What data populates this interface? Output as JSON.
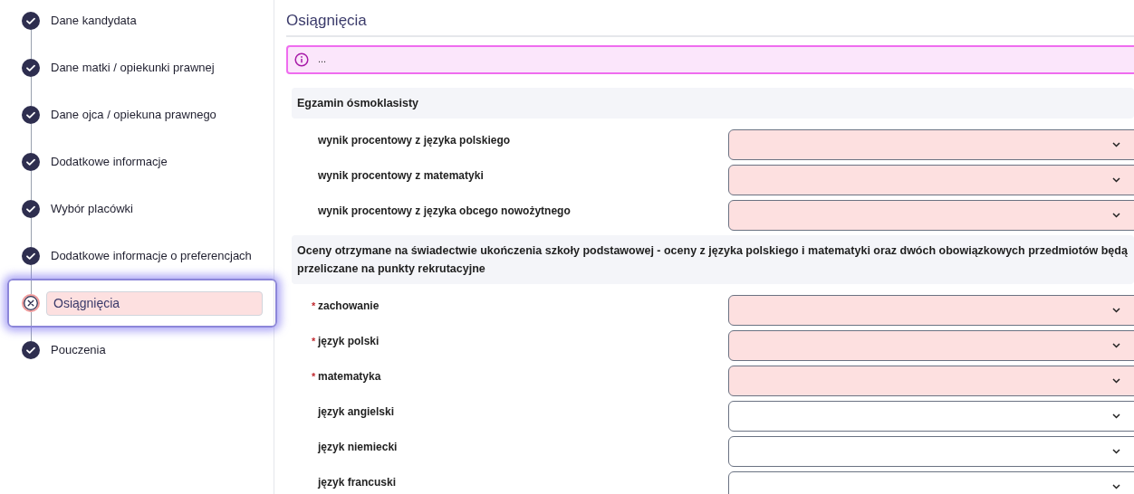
{
  "steps": [
    {
      "label": "Dane kandydata",
      "error": false,
      "selected": false
    },
    {
      "label": "Dane matki / opiekunki prawnej",
      "error": false,
      "selected": false
    },
    {
      "label": "Dane ojca / opiekuna prawnego",
      "error": false,
      "selected": false
    },
    {
      "label": "Dodatkowe informacje",
      "error": false,
      "selected": false
    },
    {
      "label": "Wybór placówki",
      "error": false,
      "selected": false
    },
    {
      "label": "Dodatkowe informacje o preferencjach",
      "error": false,
      "selected": false
    },
    {
      "label": "Osiągnięcia",
      "error": true,
      "selected": true
    },
    {
      "label": "Pouczenia",
      "error": false,
      "selected": false
    }
  ],
  "page_title": "Osiągnięcia",
  "info": {
    "text": "..."
  },
  "sections": [
    {
      "title": "Egzamin ósmoklasisty",
      "fields": [
        {
          "label": "wynik procentowy z języka polskiego",
          "invalid": true
        },
        {
          "label": "wynik procentowy z matematyki",
          "invalid": true
        },
        {
          "label": "wynik procentowy z języka obcego nowożytnego",
          "invalid": true
        }
      ]
    },
    {
      "title": "Oceny otrzymane na świadectwie ukończenia szkoły podstawowej - oceny z języka polskiego i matematyki oraz dwóch obowiązkowych przedmiotów będą przeliczane na punkty rekrutacyjne",
      "fields": [
        {
          "required_mark": "*",
          "label": "zachowanie",
          "invalid": true
        },
        {
          "required_mark": "*",
          "label": "język polski",
          "invalid": true
        },
        {
          "required_mark": "*",
          "label": "matematyka",
          "invalid": true
        },
        {
          "label": "język angielski",
          "invalid": false
        },
        {
          "label": "język niemiecki",
          "invalid": false
        },
        {
          "label": "język francuski",
          "invalid": false
        }
      ]
    }
  ]
}
